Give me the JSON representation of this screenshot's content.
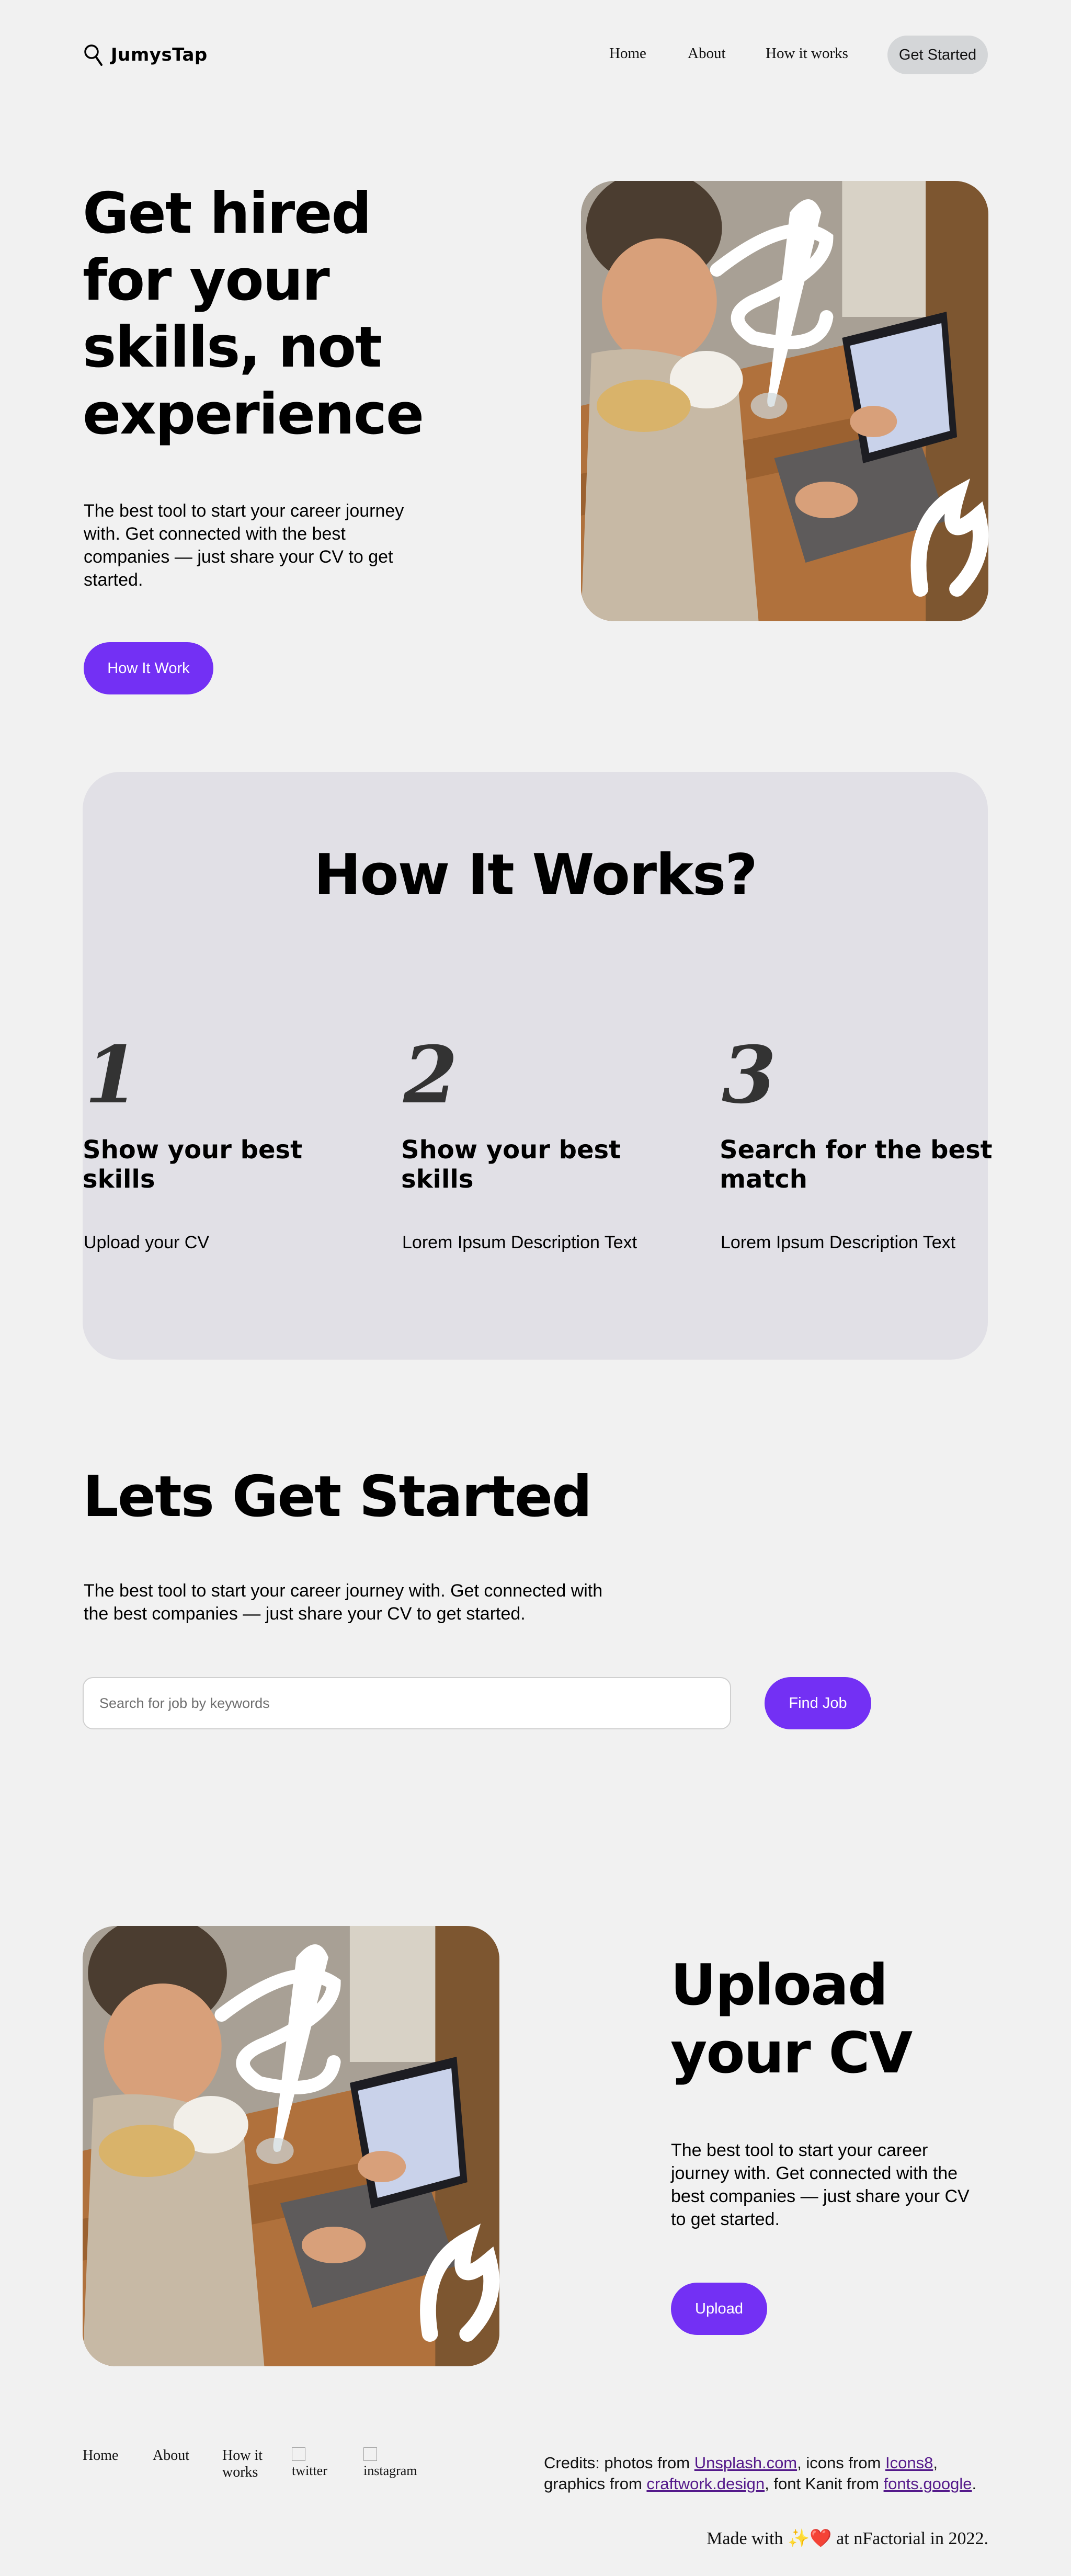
{
  "nav": {
    "logo_text": "JumysTap",
    "links": [
      "Home",
      "About",
      "How it works"
    ],
    "cta_label": "Get Started"
  },
  "hero": {
    "title": "Get hired for your skills, not experience",
    "description": "The best tool to start your career journey with. Get connected with the best companies — just share your CV to get started.",
    "button_label": "How It Work"
  },
  "how_it_works": {
    "title": "How It Works?",
    "steps": [
      {
        "number": "1",
        "title": "Show your best skills",
        "description": "Upload your CV"
      },
      {
        "number": "2",
        "title": "Show your best skills",
        "description": "Lorem Ipsum Description Text"
      },
      {
        "number": "3",
        "title": "Search for the best match",
        "description": "Lorem Ipsum Description Text"
      }
    ]
  },
  "get_started": {
    "title": "Lets Get Started",
    "description": "The best tool to start your career journey with. Get connected with the best companies — just share your CV to get started.",
    "search_placeholder": "Search for job by keywords",
    "search_value": "",
    "button_label": "Find Job"
  },
  "upload": {
    "title": "Upload your CV",
    "description": "The best tool to start your career journey with. Get connected with the best companies — just share your CV to get started.",
    "button_label": "Upload"
  },
  "footer": {
    "links": [
      "Home",
      "About",
      "How it works"
    ],
    "social_alts": [
      "twitter",
      "instagram"
    ],
    "credits": {
      "prefix": "Credits: photos from ",
      "link1": "Unsplash.com",
      "mid1": ", icons from ",
      "link2": "Icons8",
      "mid2": ", graphics from ",
      "link3": "craftwork.design",
      "mid3": ", font Kanit from ",
      "link4": "fonts.google",
      "suffix": "."
    },
    "made_with": {
      "prefix": "Made with ",
      "emoji": "✨❤️",
      "suffix": " at nFactorial in 2022."
    }
  },
  "colors": {
    "background": "#f1f1f1",
    "accent": "#7330f4",
    "panel": "#e1e0e6",
    "nav_button": "#d4d6d8"
  },
  "icons": {
    "logo": "search-icon"
  }
}
